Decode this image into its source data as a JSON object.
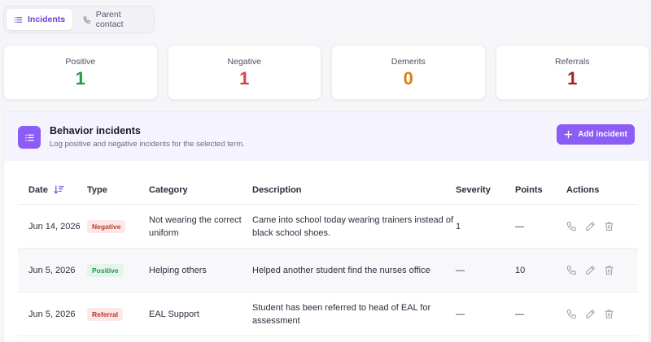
{
  "tabs": [
    {
      "label": "Incidents",
      "icon": "list-icon",
      "active": true
    },
    {
      "label": "Parent contact",
      "icon": "phone-icon",
      "active": false
    }
  ],
  "stats": [
    {
      "label": "Positive",
      "value": "1",
      "color": "#1f9b4b"
    },
    {
      "label": "Negative",
      "value": "1",
      "color": "#d9434a"
    },
    {
      "label": "Demerits",
      "value": "0",
      "color": "#d98012"
    },
    {
      "label": "Referrals",
      "value": "1",
      "color": "#a3202c"
    }
  ],
  "panel": {
    "title": "Behavior incidents",
    "subtitle": "Log positive and negative incidents for the selected term.",
    "add_label": "Add incident",
    "accent": "#8b5cf6"
  },
  "table": {
    "headers": {
      "date": "Date",
      "type": "Type",
      "category": "Category",
      "description": "Description",
      "severity": "Severity",
      "points": "Points",
      "actions": "Actions"
    },
    "rows": [
      {
        "date": "Jun 14, 2026",
        "type": "Negative",
        "category": "Not wearing the correct uniform",
        "description": "Came into school today wearing trainers instead of black school shoes.",
        "severity": "1",
        "points": "—"
      },
      {
        "date": "Jun 5, 2026",
        "type": "Positive",
        "category": "Helping others",
        "description": "Helped another student find the nurses office",
        "severity": "—",
        "points": "10"
      },
      {
        "date": "Jun 5, 2026",
        "type": "Referral",
        "category": "EAL Support",
        "description": "Student has been referred to head of EAL for assessment",
        "severity": "—",
        "points": "—"
      }
    ]
  }
}
